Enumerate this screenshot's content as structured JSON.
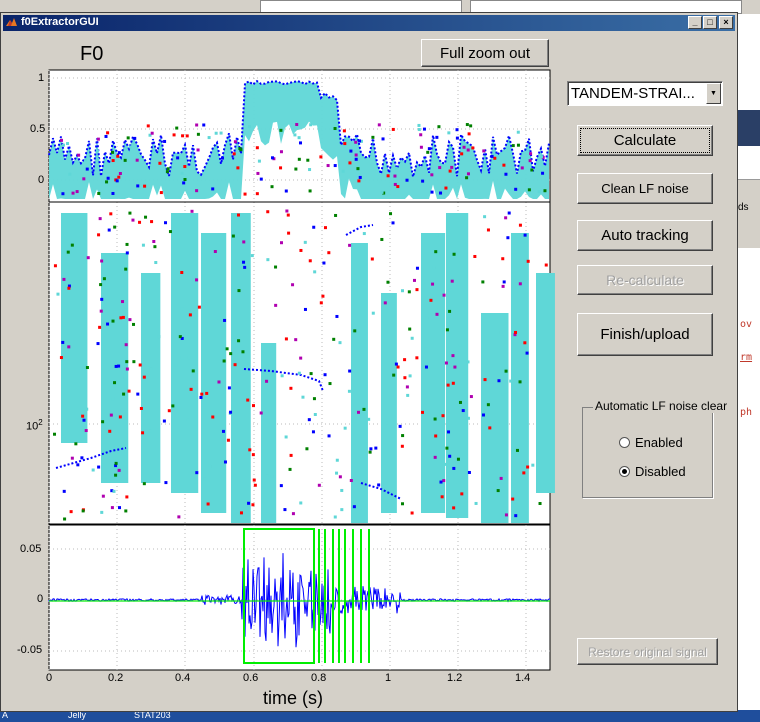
{
  "desktop": {
    "right_texts": [
      "ov",
      "rm",
      "ph"
    ],
    "right_small": "ds",
    "taskbar": [
      "A",
      "Jelly",
      "STAT203"
    ]
  },
  "window": {
    "title": "f0ExtractorGUI",
    "btn_min": "_",
    "btn_max": "□",
    "btn_close": "×"
  },
  "plot": {
    "title": "F0",
    "top_yticks": [
      "1",
      "0.5",
      "0"
    ],
    "f0_ytick": "10",
    "f0_ytick_exp": "2",
    "wave_yticks": [
      "0.05",
      "0",
      "-0.05"
    ],
    "xticks": [
      "0",
      "0.2",
      "0.4",
      "0.6",
      "0.8",
      "1",
      "1.2",
      "1.4"
    ],
    "xlabel": "time (s)"
  },
  "controls": {
    "full_zoom_out": "Full zoom out",
    "method_select": "TANDEM-STRAI...",
    "calculate": "Calculate",
    "clean_lf": "Clean LF noise",
    "auto_tracking": "Auto tracking",
    "recalculate": "Re-calculate",
    "finish_upload": "Finish/upload",
    "restore": "Restore original signal"
  },
  "lf_group": {
    "legend": "Automatic LF noise clear",
    "enabled": "Enabled",
    "disabled": "Disabled",
    "selected": "Disabled"
  },
  "colors": {
    "cyan": "#5fd7d7",
    "blue": "#0000ff",
    "green": "#00ee00",
    "red": "#ff0000",
    "darkgreen": "#008000",
    "magenta": "#b000b0"
  }
}
